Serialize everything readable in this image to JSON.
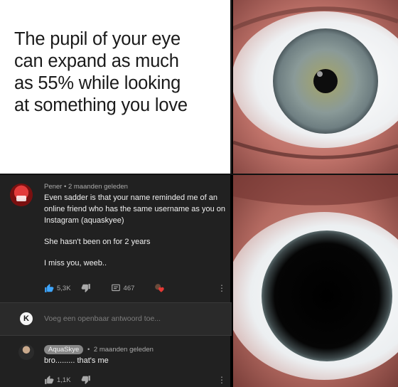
{
  "caption": {
    "lines": [
      "The pupil of your eye",
      "can expand as much",
      "as 55% while looking",
      "at something you love"
    ]
  },
  "comment": {
    "author": "Pener",
    "separator": "•",
    "time": "2 maanden geleden",
    "paragraphs": [
      "Even sadder is that your name reminded me of an online friend who has the same username as you on Instagram (aquaskyee)",
      "She hasn't been on for 2 years",
      "I miss you, weeb.."
    ],
    "like_count": "5,3K",
    "reply_count": "467",
    "more_glyph": "⋮"
  },
  "reply_box": {
    "avatar_letter": "K",
    "placeholder": "Voeg een openbaar antwoord toe..."
  },
  "reply": {
    "author": "AquaSkye",
    "separator": "•",
    "time": "2 maanden geleden",
    "text": "bro......... that's me",
    "like_count": "1,1K",
    "more_glyph": "⋮"
  },
  "colors": {
    "dark_bg": "#212121",
    "heart": "#e53935",
    "like_blue": "#3ea6ff"
  },
  "icons": [
    "thumbs-up-icon",
    "thumbs-down-icon",
    "reply-icon",
    "heart-icon",
    "more-vert-icon"
  ]
}
